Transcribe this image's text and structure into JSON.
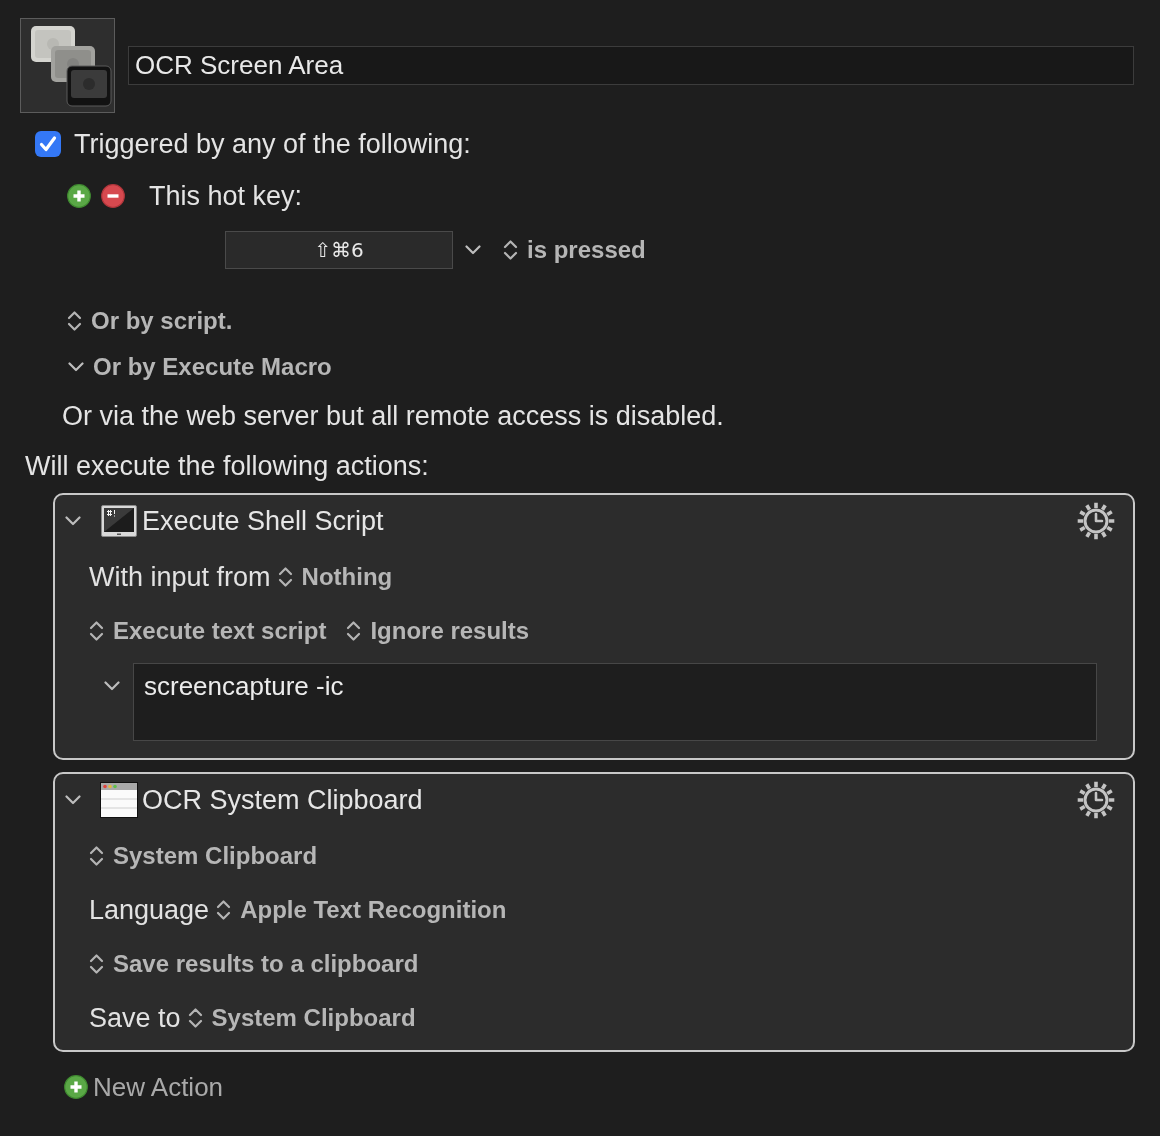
{
  "macro": {
    "name": "OCR Screen Area"
  },
  "trigger": {
    "checked": true,
    "label": "Triggered by any of the following:"
  },
  "hot_key": {
    "label": "This hot key:",
    "keys": "⇧⌘6",
    "condition": "is pressed"
  },
  "other_triggers": [
    {
      "kind": "popup",
      "label": "Or by script."
    },
    {
      "kind": "menu",
      "label": "Or by Execute Macro"
    }
  ],
  "web_server_note": "Or via the web server but all remote access is disabled.",
  "actions_heading": "Will execute the following actions:",
  "actions": [
    {
      "kind": "shell_script",
      "title": "Execute Shell Script",
      "expanded": true,
      "rows": [
        {
          "kind": "labeled_popup",
          "label": "With input from",
          "value": "Nothing"
        },
        {
          "kind": "popups",
          "values": [
            "Execute text script",
            "Ignore results"
          ]
        },
        {
          "kind": "script",
          "text": "screencapture -ic",
          "expanded": true
        }
      ]
    },
    {
      "kind": "ocr",
      "title": "OCR System Clipboard",
      "expanded": true,
      "rows": [
        {
          "kind": "popups",
          "values": [
            "System Clipboard"
          ]
        },
        {
          "kind": "labeled_popup",
          "label": "Language",
          "value": "Apple Text Recognition"
        },
        {
          "kind": "popups",
          "values": [
            "Save results to a clipboard"
          ]
        },
        {
          "kind": "labeled_popup",
          "label": "Save to",
          "value": "System Clipboard"
        }
      ]
    }
  ],
  "new_action": {
    "label": "New Action"
  }
}
